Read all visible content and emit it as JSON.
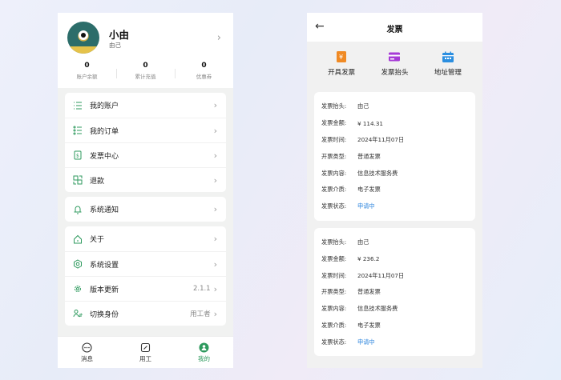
{
  "profile": {
    "name": "小由",
    "identity": "由己",
    "stats": [
      {
        "value": "0",
        "label": "账户余额"
      },
      {
        "value": "0",
        "label": "累计充值"
      },
      {
        "value": "0",
        "label": "优惠券"
      }
    ]
  },
  "menu": {
    "group1": [
      {
        "label": "我的账户",
        "icon": "list-icon"
      },
      {
        "label": "我的订单",
        "icon": "orders-icon"
      },
      {
        "label": "发票中心",
        "icon": "invoice-icon"
      },
      {
        "label": "退款",
        "icon": "refund-icon"
      }
    ],
    "group2": [
      {
        "label": "系统通知",
        "icon": "bell-icon"
      }
    ],
    "group3": [
      {
        "label": "关于",
        "icon": "home-icon",
        "value": ""
      },
      {
        "label": "系统设置",
        "icon": "settings-icon",
        "value": ""
      },
      {
        "label": "版本更新",
        "icon": "gear-icon",
        "value": "2.1.1"
      },
      {
        "label": "切换身份",
        "icon": "switch-user-icon",
        "value": "用工者"
      }
    ]
  },
  "tabbar": [
    {
      "label": "消息",
      "icon": "message-icon"
    },
    {
      "label": "用工",
      "icon": "work-icon"
    },
    {
      "label": "我的",
      "icon": "profile-icon"
    }
  ],
  "invoice_page": {
    "title": "发票",
    "actions": [
      {
        "label": "开具发票",
        "icon": "issue-invoice-icon",
        "color": "#f08a24"
      },
      {
        "label": "发票抬头",
        "icon": "invoice-header-icon",
        "color": "#a63bd6"
      },
      {
        "label": "地址管理",
        "icon": "address-icon",
        "color": "#2c8fe0"
      }
    ],
    "field_labels": {
      "header": "发票抬头:",
      "amount": "发票金额:",
      "time": "发票时间:",
      "type": "开票类型:",
      "content": "发票内容:",
      "medium": "发票介质:",
      "status": "发票状态:"
    },
    "invoices": [
      {
        "header": "由己",
        "amount": "¥ 114.31",
        "time": "2024年11月07日",
        "type": "普通发票",
        "content": "信息技术服务费",
        "medium": "电子发票",
        "status": "申请中"
      },
      {
        "header": "由己",
        "amount": "¥ 236.2",
        "time": "2024年11月07日",
        "type": "普通发票",
        "content": "信息技术服务费",
        "medium": "电子发票",
        "status": "申请中"
      }
    ]
  },
  "colors": {
    "accent": "#2e9a5e",
    "status": "#2e86de"
  }
}
